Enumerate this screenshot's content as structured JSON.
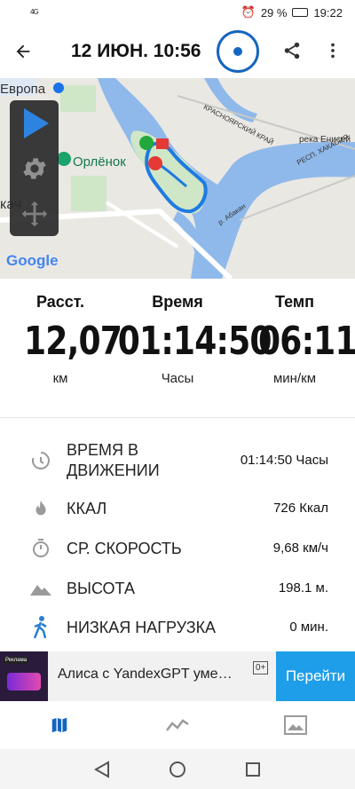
{
  "status_bar": {
    "signal": "4G",
    "battery": "29 %",
    "time": "19:22"
  },
  "header": {
    "title": "12 ИЮН. 10:56"
  },
  "map": {
    "labels": {
      "europe": "Европа",
      "orlenok": "Орлёнок",
      "krai": "КРАСНОЯРСКИЙ КРАЙ",
      "river": "река Енисей",
      "republic": "РЕСП. ХАКАСИЯ",
      "abakan": "р. Абакан",
      "left_cut": "кач"
    },
    "google_logo": "Google"
  },
  "summary": [
    {
      "label": "Расст.",
      "value": "12,07",
      "unit": "км"
    },
    {
      "label": "Время",
      "value": "01:14:50",
      "unit": "Часы"
    },
    {
      "label": "Темп",
      "value": "06:11",
      "unit": "мин/км"
    }
  ],
  "details": [
    {
      "icon": "moving-time-icon",
      "name": "ВРЕМЯ В\nДВИЖЕНИИ",
      "value": "01:14:50 Часы"
    },
    {
      "icon": "flame-icon",
      "name": "ККАЛ",
      "value": "726 Ккал"
    },
    {
      "icon": "stopwatch-icon",
      "name": "СР. СКОРОСТЬ",
      "value": "9,68 км/ч"
    },
    {
      "icon": "mountain-icon",
      "name": "ВЫСОТА",
      "value": "198.1 м."
    },
    {
      "icon": "walker-icon",
      "name": "НИЗКАЯ НАГРУЗКА",
      "value": "0 мин."
    }
  ],
  "ad": {
    "text": "Алиса с YandexGPT уме…",
    "age": "0+",
    "cta": "Перейти",
    "badge": "Реклама"
  },
  "colors": {
    "accent": "#1565c0",
    "ad_button": "#1e9ee8",
    "route": "#1e7be0",
    "water": "#8fb9ea",
    "park": "#cfe6c7"
  }
}
